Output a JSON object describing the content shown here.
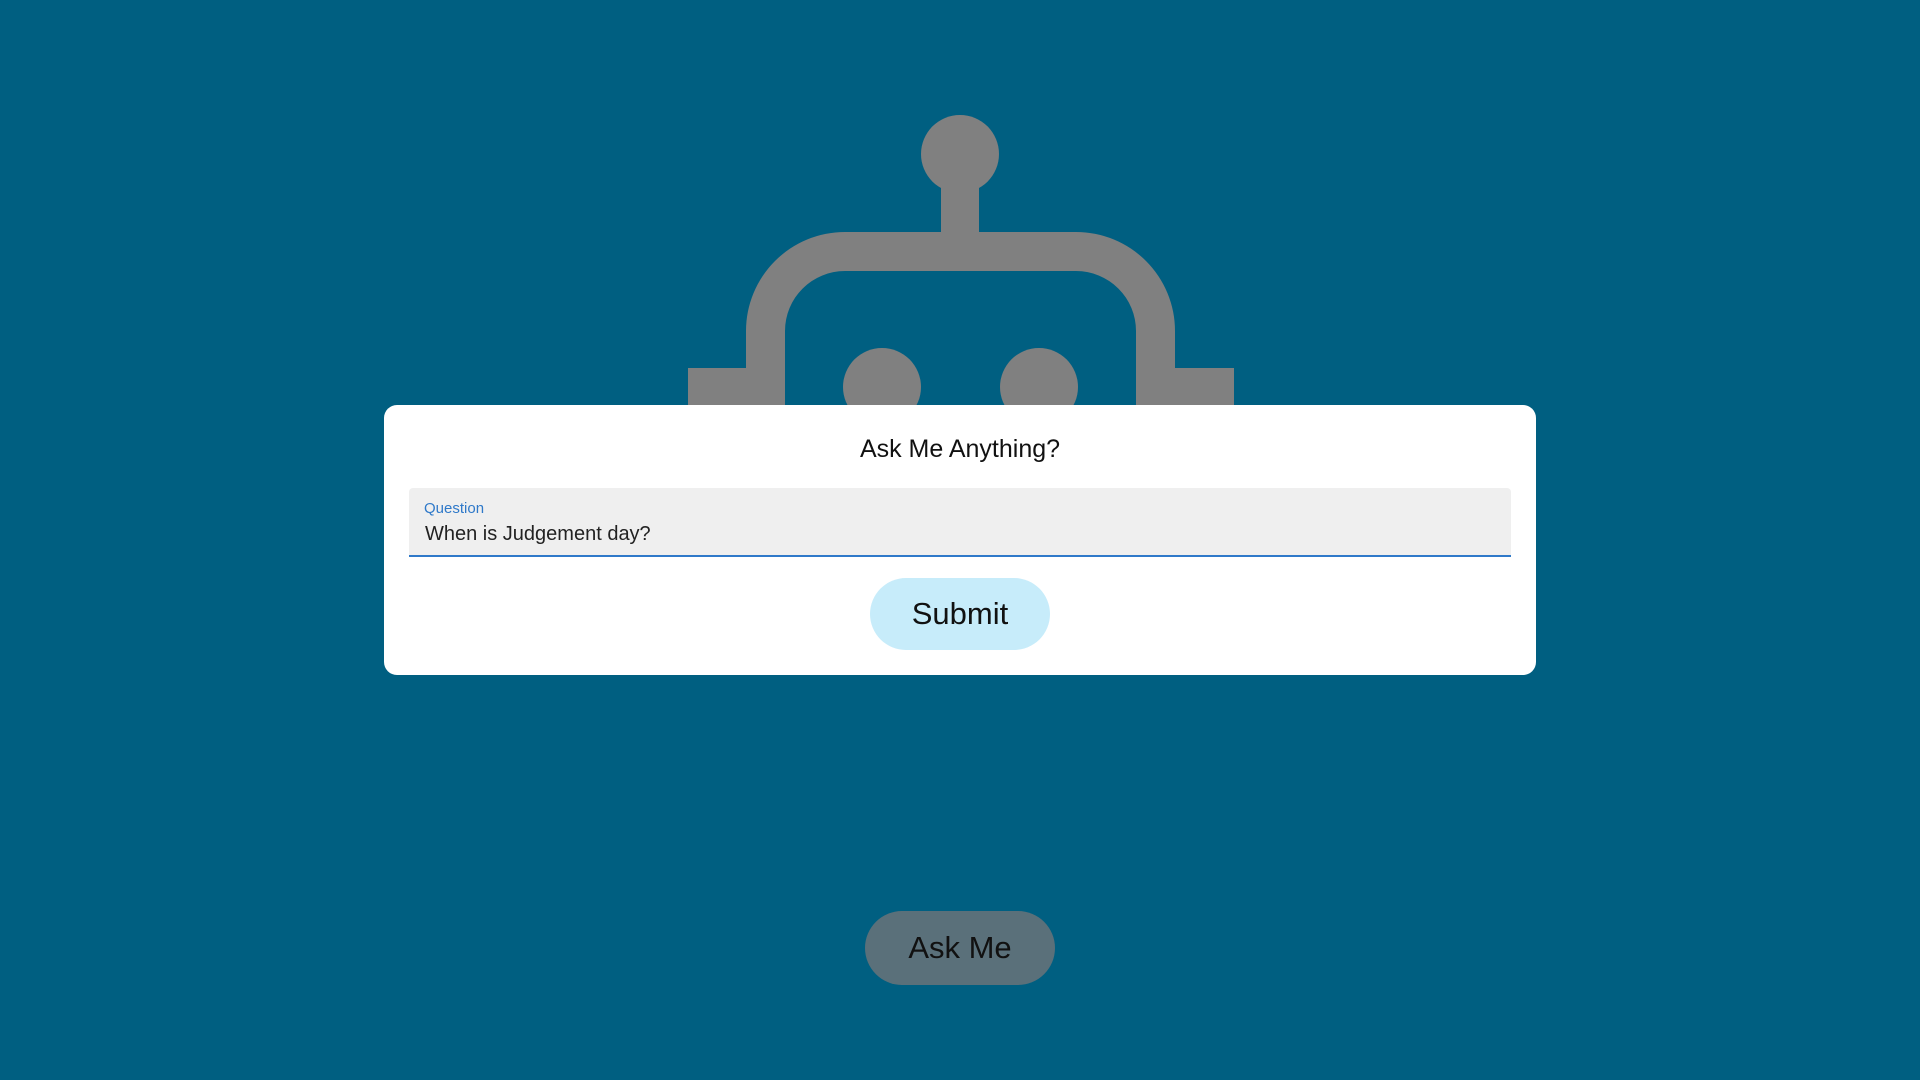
{
  "colors": {
    "background": "#005f81",
    "card": "#ffffff",
    "field_bg": "#efefef",
    "accent": "#2f79c9",
    "submit_bg": "#c7ecfa",
    "ask_bg": "#5a707a",
    "robot": "#808080"
  },
  "background_icon": "robot-icon",
  "card": {
    "title": "Ask Me Anything?",
    "question_field": {
      "label": "Question",
      "value": "When is Judgement day?"
    },
    "submit_label": "Submit"
  },
  "ask_me_label": "Ask Me"
}
